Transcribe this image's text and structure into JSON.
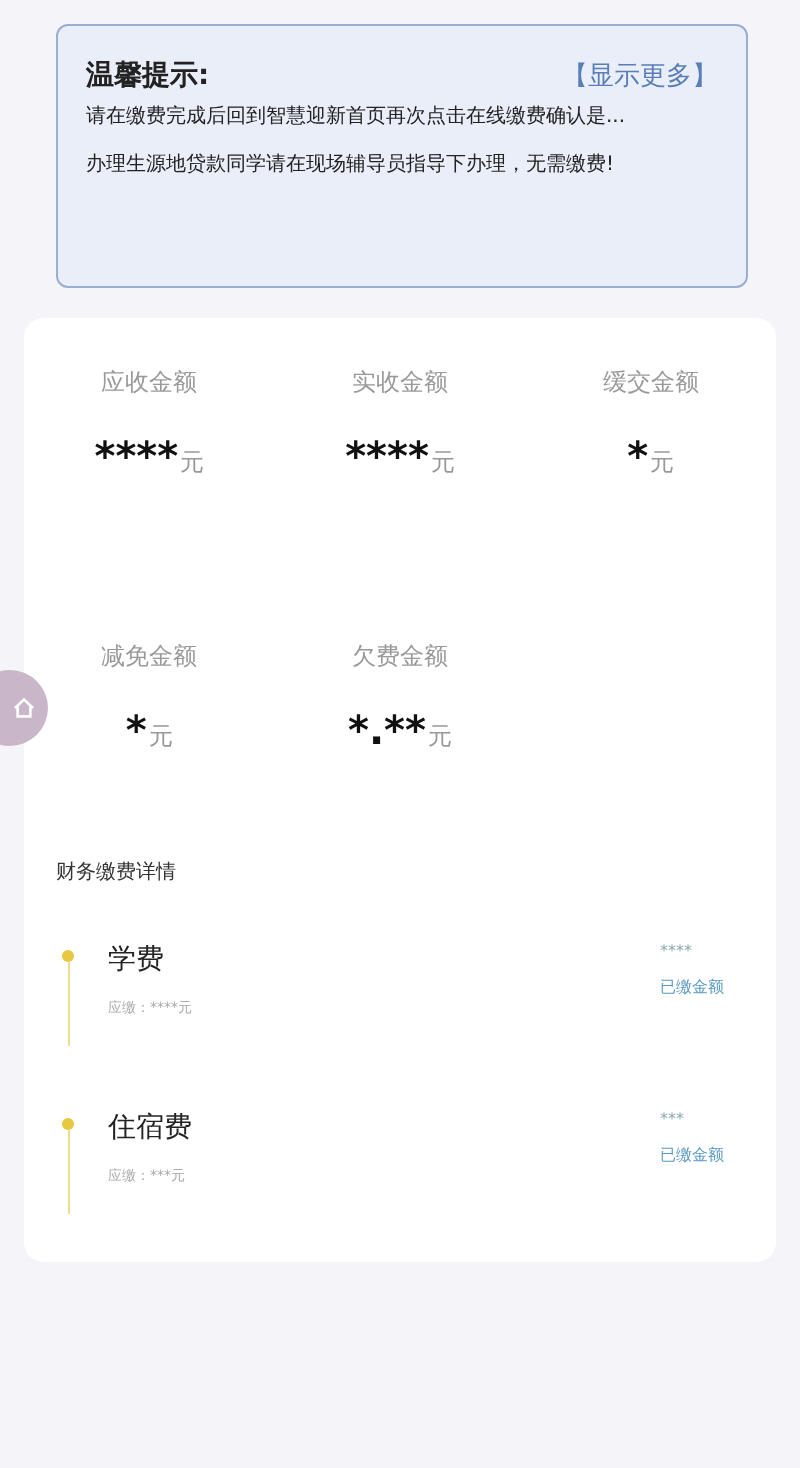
{
  "notice": {
    "title": "温馨提示:",
    "more_link": "【显示更多】",
    "lines": [
      "请在缴费完成后回到智慧迎新首页再次点击在线缴费确认是...",
      "办理生源地贷款同学请在现场辅导员指导下办理，无需缴费!"
    ]
  },
  "summary": [
    {
      "label": "应收金额",
      "value": "****",
      "unit": "元"
    },
    {
      "label": "实收金额",
      "value": "****",
      "unit": "元"
    },
    {
      "label": "缓交金额",
      "value": "*",
      "unit": "元"
    },
    {
      "label": "减免金额",
      "value": "*",
      "unit": "元"
    },
    {
      "label": "欠费金额",
      "value": "*.**",
      "unit": "元"
    }
  ],
  "details": {
    "title": "财务缴费详情",
    "items": [
      {
        "name": "学费",
        "due": "应缴：****元",
        "paid": "****",
        "paid_label": "已缴金额",
        "color": "#e8c840"
      },
      {
        "name": "住宿费",
        "due": "应缴：***元",
        "paid": "***",
        "paid_label": "已缴金额",
        "color": "#e8c840"
      }
    ]
  }
}
